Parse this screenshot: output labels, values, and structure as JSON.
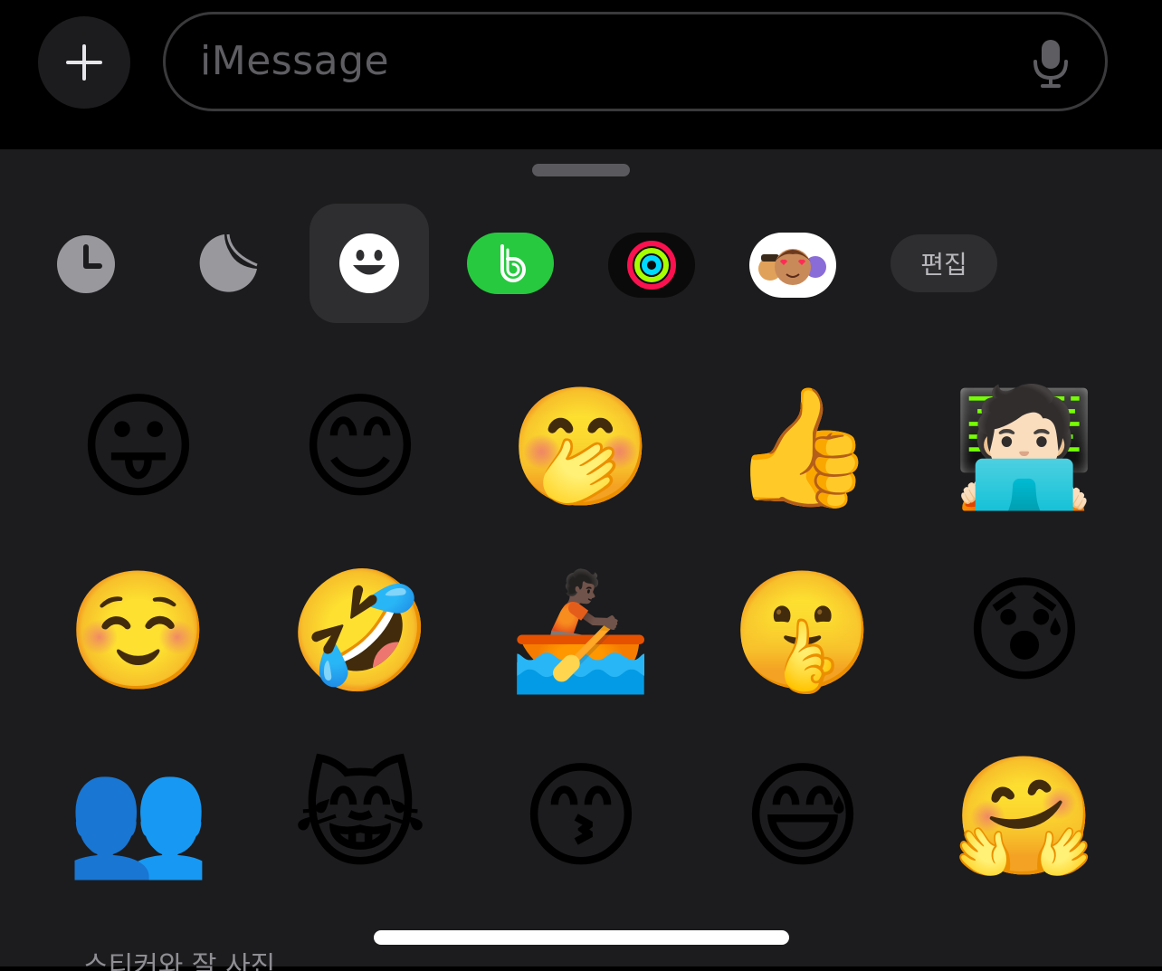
{
  "input_bar": {
    "placeholder": "iMessage",
    "plus_icon": "plus-icon",
    "mic_icon": "microphone-icon"
  },
  "app_drawer": {
    "apps": [
      {
        "name": "recents",
        "icon": "clock-icon",
        "selected": false
      },
      {
        "name": "stickers",
        "icon": "stickers-icon",
        "selected": false
      },
      {
        "name": "emoji",
        "icon": "smiley-icon",
        "selected": true
      },
      {
        "name": "band",
        "icon": "band-app-icon",
        "selected": false
      },
      {
        "name": "activity",
        "icon": "activity-rings-icon",
        "selected": false
      },
      {
        "name": "memoji",
        "icon": "memoji-stickers-icon",
        "selected": false
      }
    ],
    "edit_label": "편집"
  },
  "emoji_grid": {
    "rows": [
      [
        "😛",
        "😊",
        "🤭",
        "👍",
        "🧑🏻‍💻"
      ],
      [
        "☺️",
        "🤣",
        "🚣🏿",
        "🤫",
        "😰"
      ],
      [
        "👥",
        "😹",
        "😙",
        "😅",
        "🤗"
      ]
    ]
  },
  "section_label": "스티커와 잘 사진"
}
